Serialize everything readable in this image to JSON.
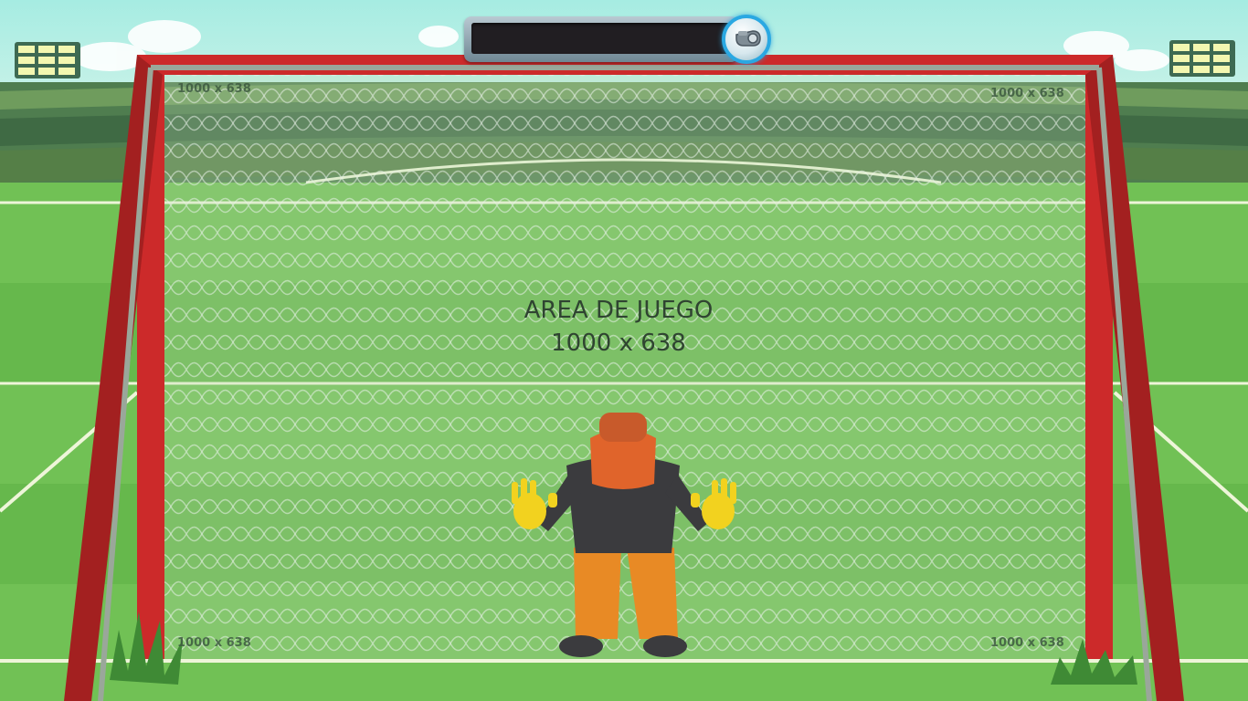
{
  "game": {
    "play_area_title": "AREA DE JUEGO",
    "play_area_size": "1000 x 638",
    "corner_labels": {
      "top_left": "1000 x 638",
      "top_right": "1000 x 638",
      "bottom_left": "1000 x 638",
      "bottom_right": "1000 x 638"
    }
  },
  "hud": {
    "timer_bar_progress": 1.0,
    "whistle_icon": "whistle-icon"
  },
  "colors": {
    "sky": "#9fe3de",
    "grass_light": "#7ccc5e",
    "grass_dark": "#5cae43",
    "goal_post_red": "#cc2a2a",
    "net": "#e8f1e8",
    "keeper_hair": "#e0642b",
    "keeper_shirt": "#3b3b3e",
    "keeper_pants": "#e88a25",
    "keeper_gloves": "#f2d21f",
    "whistle_ring": "#2aa8e2"
  }
}
